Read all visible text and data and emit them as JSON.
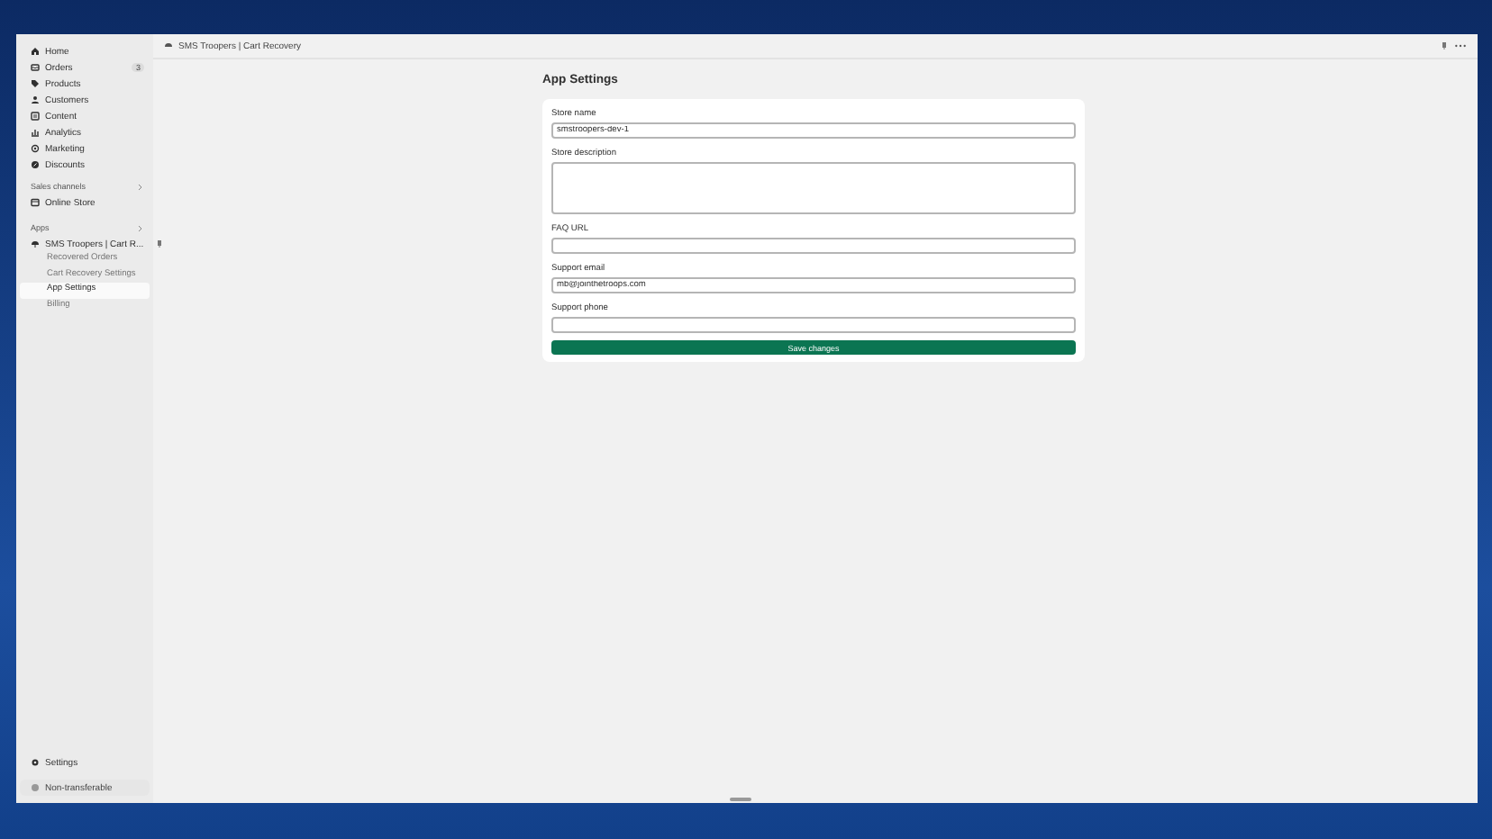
{
  "topbar": {
    "app_title": "SMS Troopers | Cart Recovery"
  },
  "sidebar": {
    "items": [
      {
        "label": "Home",
        "kind": "home",
        "selected": false
      },
      {
        "label": "Orders",
        "kind": "orders",
        "badge": "3",
        "selected": false
      },
      {
        "label": "Products",
        "kind": "tag",
        "selected": false
      },
      {
        "label": "Customers",
        "kind": "person",
        "selected": false
      },
      {
        "label": "Content",
        "kind": "content",
        "selected": false
      },
      {
        "label": "Analytics",
        "kind": "chart",
        "selected": false
      },
      {
        "label": "Marketing",
        "kind": "target",
        "selected": false
      },
      {
        "label": "Discounts",
        "kind": "discount",
        "selected": false
      }
    ],
    "sales_channels": {
      "heading": "Sales channels",
      "items": [
        {
          "label": "Online Store",
          "kind": "store",
          "selected": false
        }
      ]
    },
    "apps": {
      "heading": "Apps",
      "app": {
        "label": "SMS Troopers | Cart R...",
        "children": [
          {
            "label": "Recovered Orders",
            "selected": false
          },
          {
            "label": "Cart Recovery Settings",
            "selected": false
          },
          {
            "label": "App Settings",
            "selected": true
          },
          {
            "label": "Billing",
            "selected": false
          }
        ]
      }
    },
    "settings": "Settings",
    "footer": "Non-transferable"
  },
  "page": {
    "title": "App Settings",
    "fields": [
      {
        "label": "Store name",
        "kind": "input",
        "value": "smstroopers-dev-1"
      },
      {
        "label": "Store description",
        "kind": "textarea"
      },
      {
        "label": "FAQ URL",
        "kind": "input"
      },
      {
        "label": "Support email",
        "kind": "input",
        "value": "mb@jointhetroops.com"
      },
      {
        "label": "Support phone",
        "kind": "input"
      }
    ],
    "save_button": "Save changes"
  }
}
